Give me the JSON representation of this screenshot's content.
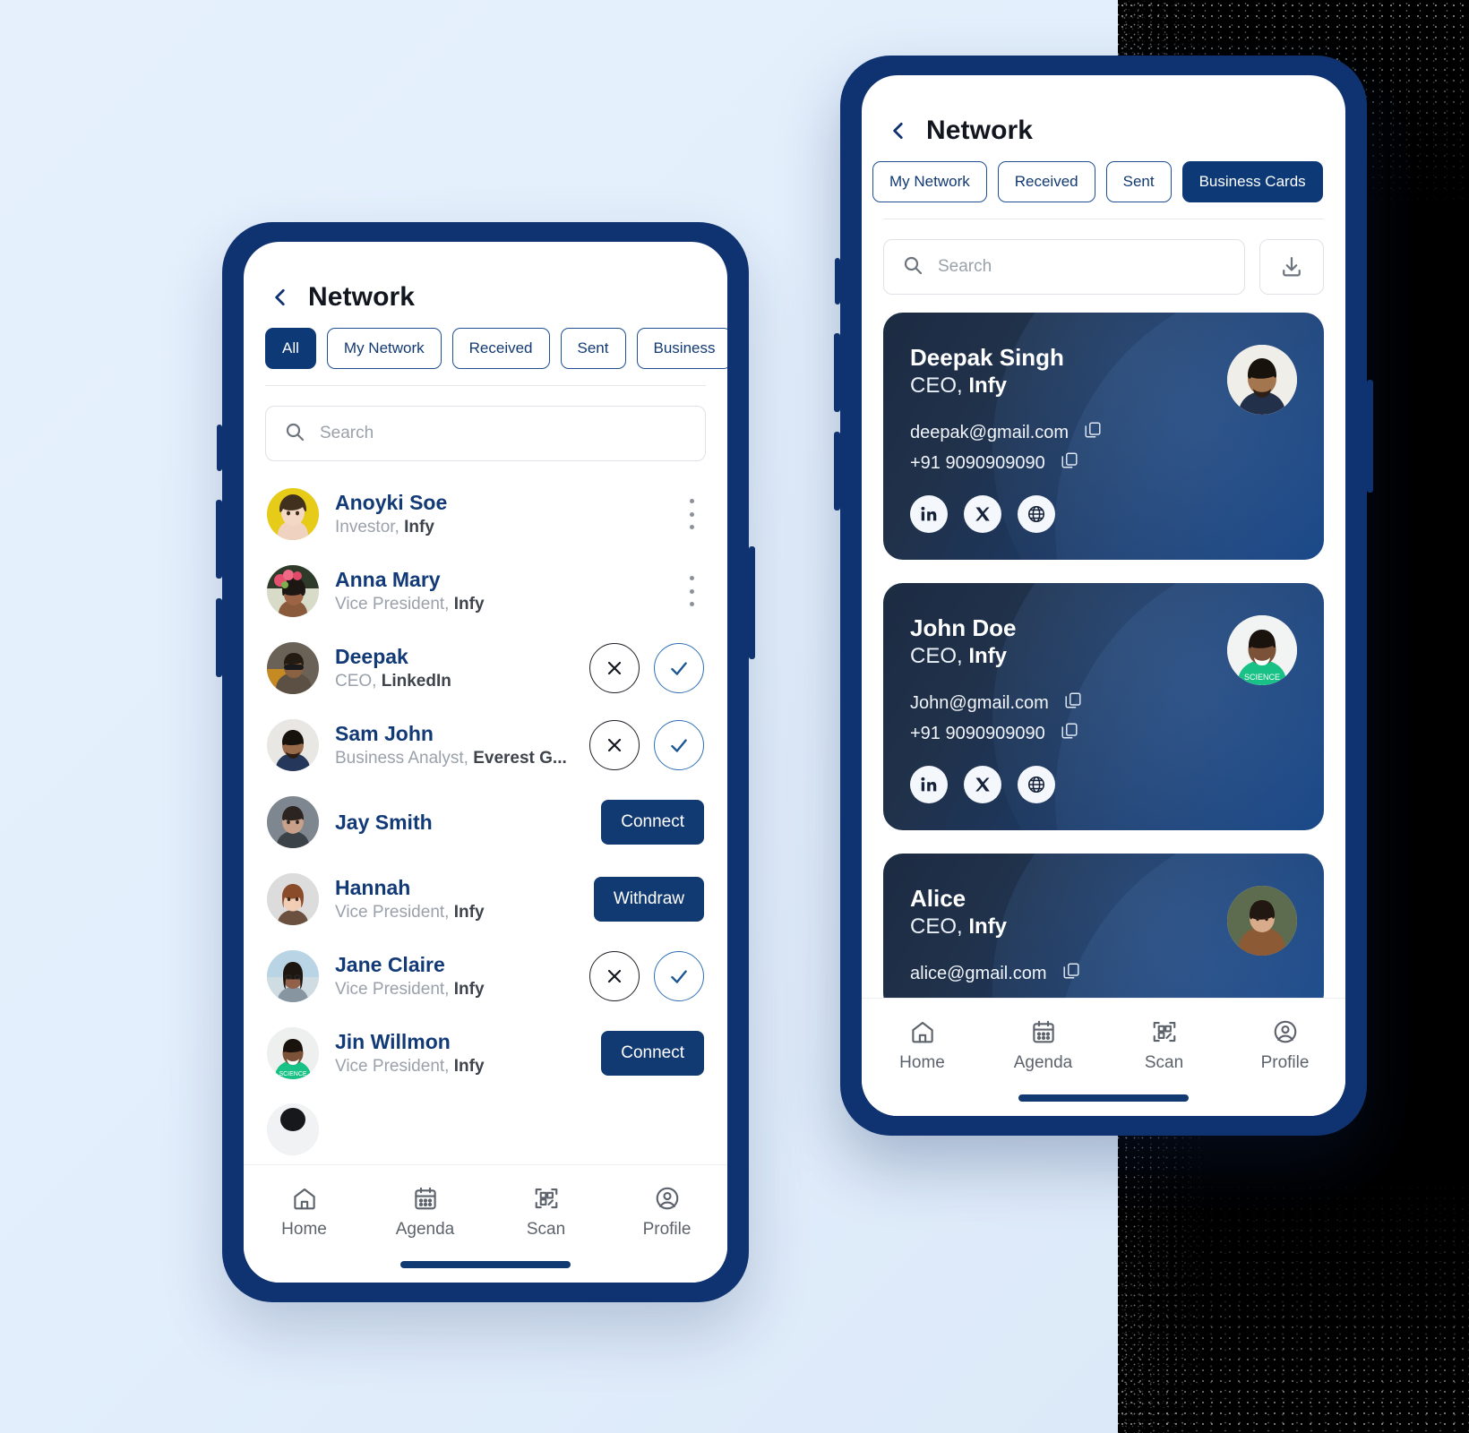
{
  "background": {
    "light_color": "#e3effc",
    "dark_color": "#000000",
    "brand_navy": "#0f3270",
    "accent_blue": "#123a72"
  },
  "left_phone": {
    "header": {
      "title": "Network",
      "back_icon": "chevron-left-icon"
    },
    "tabs": [
      {
        "label": "All",
        "active": true
      },
      {
        "label": "My Network",
        "active": false
      },
      {
        "label": "Received",
        "active": false
      },
      {
        "label": "Sent",
        "active": false
      },
      {
        "label": "Business",
        "active": false
      }
    ],
    "search": {
      "placeholder": "Search",
      "value": "",
      "icon": "search-icon"
    },
    "contacts": [
      {
        "name": "Anoyki Soe",
        "role": "Investor,",
        "company": "Infy",
        "action": "kebab",
        "avatar": "woman-yellow-bg"
      },
      {
        "name": "Anna Mary",
        "role": "Vice President,",
        "company": "Infy",
        "action": "kebab",
        "avatar": "woman-flowers"
      },
      {
        "name": "Deepak",
        "role": "CEO,",
        "company": "LinkedIn",
        "action": "accept-decline",
        "avatar": "man-sunglasses"
      },
      {
        "name": "Sam John",
        "role": "Business Analyst,",
        "company": "Everest G...",
        "action": "accept-decline",
        "avatar": "man-beard"
      },
      {
        "name": "Jay Smith",
        "role": "",
        "company": "",
        "action": "connect",
        "button_label": "Connect",
        "avatar": "man-grey"
      },
      {
        "name": "Hannah",
        "role": "Vice President,",
        "company": "Infy",
        "action": "withdraw",
        "button_label": "Withdraw",
        "avatar": "woman-redhair"
      },
      {
        "name": "Jane Claire",
        "role": "Vice President,",
        "company": "Infy",
        "action": "accept-decline",
        "avatar": "woman-glasses"
      },
      {
        "name": "Jin Willmon",
        "role": "Vice President,",
        "company": "Infy",
        "action": "connect",
        "button_label": "Connect",
        "avatar": "man-green-shirt"
      }
    ],
    "bottom_nav": [
      {
        "label": "Home",
        "icon": "home-icon"
      },
      {
        "label": "Agenda",
        "icon": "calendar-icon"
      },
      {
        "label": "Scan",
        "icon": "qr-scan-icon"
      },
      {
        "label": "Profile",
        "icon": "user-circle-icon"
      }
    ]
  },
  "right_phone": {
    "header": {
      "title": "Network",
      "back_icon": "chevron-left-icon"
    },
    "tabs": [
      {
        "label": "My Network",
        "active": false
      },
      {
        "label": "Received",
        "active": false
      },
      {
        "label": "Sent",
        "active": false
      },
      {
        "label": "Business Cards",
        "active": true
      }
    ],
    "search": {
      "placeholder": "Search",
      "value": "",
      "icon": "search-icon"
    },
    "download_button": {
      "icon": "download-icon"
    },
    "business_cards": [
      {
        "name": "Deepak Singh",
        "role": "CEO,",
        "company": "Infy",
        "email": "deepak@gmail.com",
        "phone": "+91 9090909090",
        "avatar": "man-beard-navy",
        "socials": [
          "linkedin-icon",
          "x-icon",
          "globe-icon"
        ],
        "copy_icon": "copy-icon"
      },
      {
        "name": "John Doe",
        "role": "CEO,",
        "company": "Infy",
        "email": "John@gmail.com",
        "phone": "+91 9090909090",
        "avatar": "man-green-shirt",
        "socials": [
          "linkedin-icon",
          "x-icon",
          "globe-icon"
        ],
        "copy_icon": "copy-icon"
      },
      {
        "name": "Alice",
        "role": "CEO,",
        "company": "Infy",
        "email": "alice@gmail.com",
        "phone": "",
        "avatar": "woman-brown-top",
        "socials": [],
        "copy_icon": "copy-icon"
      }
    ],
    "bottom_nav": [
      {
        "label": "Home",
        "icon": "home-icon"
      },
      {
        "label": "Agenda",
        "icon": "calendar-icon"
      },
      {
        "label": "Scan",
        "icon": "qr-scan-icon"
      },
      {
        "label": "Profile",
        "icon": "user-circle-icon"
      }
    ]
  }
}
